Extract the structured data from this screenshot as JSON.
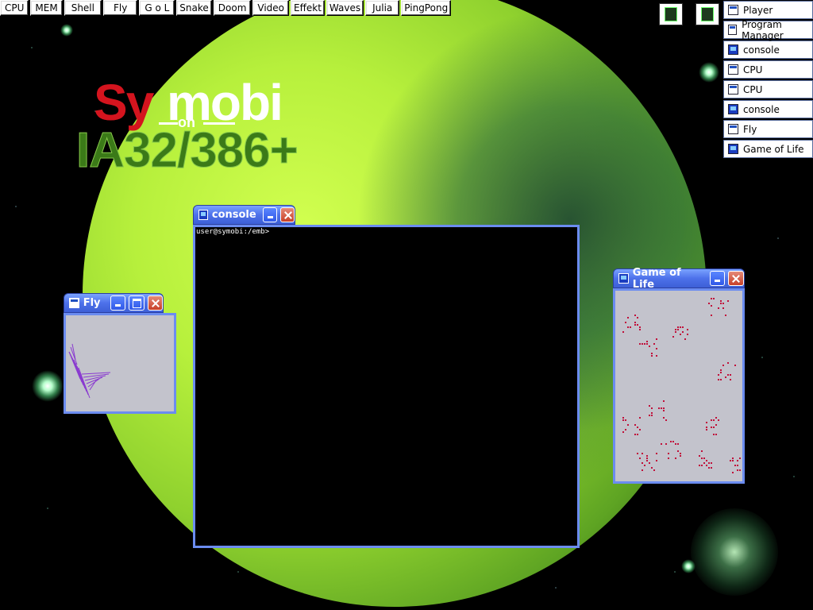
{
  "taskbar": {
    "buttons": [
      "CPU",
      "MEM",
      "Shell",
      "Fly",
      "G o L",
      "Snake",
      "Doom",
      "Video",
      "Effekt",
      "Waves",
      "Julia",
      "PingPong"
    ]
  },
  "tray": {
    "icons": [
      "cpu-chip-icon",
      "cpu-chip-icon"
    ]
  },
  "window_list": {
    "items": [
      {
        "label": "Player",
        "icon": "window-icon"
      },
      {
        "label": "Program Manager",
        "icon": "window-icon"
      },
      {
        "label": "console",
        "icon": "console-icon"
      },
      {
        "label": "CPU",
        "icon": "window-icon"
      },
      {
        "label": "CPU",
        "icon": "window-icon"
      },
      {
        "label": "console",
        "icon": "console-icon"
      },
      {
        "label": "Fly",
        "icon": "window-icon"
      },
      {
        "label": "Game of Life",
        "icon": "console-icon"
      }
    ]
  },
  "logo": {
    "sy": "Sy",
    "mobi": "mobi",
    "on": "on",
    "platform": "IA32/386+"
  },
  "console_window": {
    "title": "console",
    "prompt": "user@symobi:/emb>"
  },
  "fly_window": {
    "title": "Fly"
  },
  "gol_window": {
    "title": "Game of Life"
  },
  "colors": {
    "titlebar": "#4d71ea",
    "gol_cell": "#c0103a",
    "console_bg": "#000000"
  }
}
